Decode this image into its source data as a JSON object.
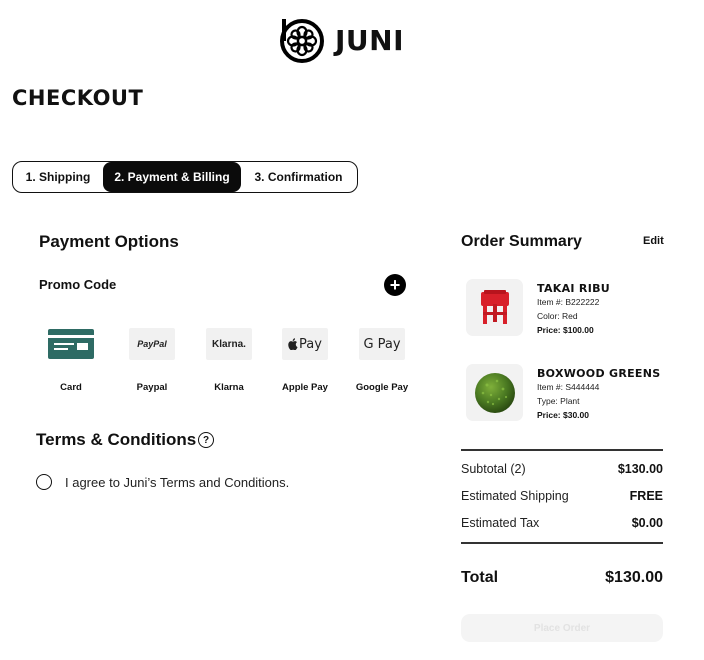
{
  "brand": {
    "name": "JUNI",
    "logo_icon": "flower-mark"
  },
  "page": {
    "title": "CHECKOUT"
  },
  "steps": [
    {
      "label": "1. Shipping",
      "active": false
    },
    {
      "label": "2. Payment & Billing",
      "active": true
    },
    {
      "label": "3. Confirmation",
      "active": false
    }
  ],
  "payment": {
    "title": "Payment Options",
    "promo_label": "Promo Code",
    "promo_add_icon": "+",
    "options": [
      {
        "label": "Card",
        "icon": "card-icon",
        "box_text": ""
      },
      {
        "label": "Paypal",
        "icon": "paypal-icon",
        "box_text": "PayPal"
      },
      {
        "label": "Klarna",
        "icon": "klarna-icon",
        "box_text": "Klarna."
      },
      {
        "label": "Apple Pay",
        "icon": "apple-pay-icon",
        "box_text": "Pay"
      },
      {
        "label": "Google Pay",
        "icon": "google-pay-icon",
        "box_text": "G Pay"
      }
    ]
  },
  "terms": {
    "title": "Terms & Conditions",
    "help_icon": "?",
    "agree_text": "I agree to Juni’s Terms and Conditions.",
    "checked": false
  },
  "summary": {
    "title": "Order Summary",
    "edit_label": "Edit",
    "items": [
      {
        "name": "TAKAI RIBU",
        "item_no": "Item #: B222222",
        "detail": "Color: Red",
        "price": "Price: $100.00",
        "image_icon": "red-stool"
      },
      {
        "name": "BOXWOOD GREENS",
        "item_no": "Item #: S444444",
        "detail": "Type: Plant",
        "price": "Price: $30.00",
        "image_icon": "boxwood-ball"
      }
    ],
    "subtotal_label": "Subtotal (2)",
    "subtotal_value": "$130.00",
    "shipping_label": "Estimated Shipping",
    "shipping_value": "FREE",
    "tax_label": "Estimated Tax",
    "tax_value": "$0.00",
    "total_label": "Total",
    "total_value": "$130.00",
    "place_order_label": "Place Order"
  },
  "colors": {
    "accent": "#0b0b0b",
    "card_teal": "#2e6b64",
    "stool_red": "#d8202a",
    "boxwood_green": "#4b7a22"
  }
}
